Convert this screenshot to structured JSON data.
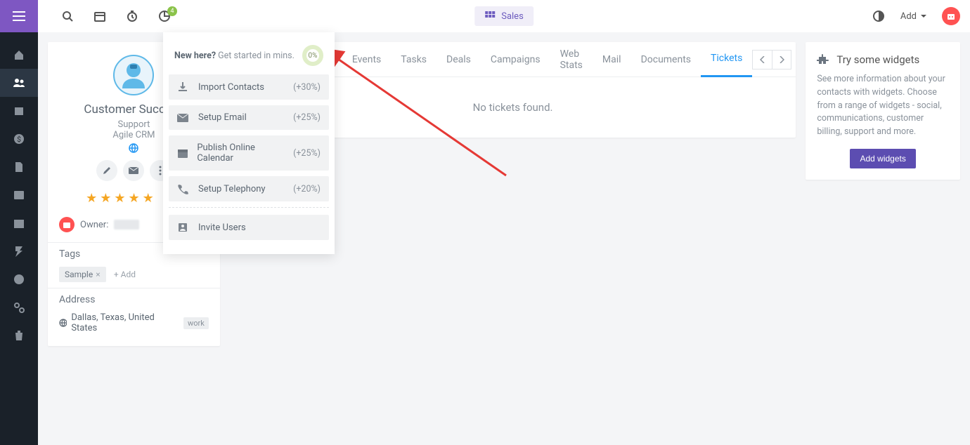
{
  "top": {
    "sales_label": "Sales",
    "add_label": "Add",
    "pie_badge": "4"
  },
  "dropdown": {
    "head_bold": "New here?",
    "head_rest": " Get started in mins.",
    "progress": "0%",
    "items": [
      {
        "label": "Import Contacts",
        "pct": "(+30%)"
      },
      {
        "label": "Setup Email",
        "pct": "(+25%)"
      },
      {
        "label": "Publish Online Calendar",
        "pct": "(+25%)"
      },
      {
        "label": "Setup Telephony",
        "pct": "(+20%)"
      }
    ],
    "invite": {
      "label": "Invite Users"
    }
  },
  "contact": {
    "name": "Customer Success",
    "role": "Support",
    "org": "Agile CRM",
    "owner_label": "Owner:",
    "tags_label": "Tags",
    "tag_sample": "Sample",
    "add_tag": "+ Add",
    "address_label": "Address",
    "address_value": "Dallas, Texas, United States",
    "address_type": "work"
  },
  "tabs": {
    "items": [
      "Events",
      "Tasks",
      "Deals",
      "Campaigns",
      "Web Stats",
      "Mail",
      "Documents",
      "Tickets"
    ],
    "active_index": 7,
    "empty": "No tickets found."
  },
  "widgets": {
    "title": "Try some widgets",
    "text": "See more information about your contacts with widgets. Choose from a range of widgets - social, communications, customer billing, support and more.",
    "button": "Add widgets"
  }
}
